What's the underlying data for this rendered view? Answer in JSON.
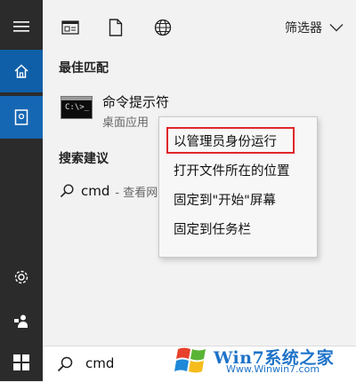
{
  "toolbar": {
    "filter_label": "筛选器",
    "icons": [
      "document-window-icon",
      "file-icon",
      "globe-icon",
      "chevron-down-icon"
    ]
  },
  "rail": {
    "icons": [
      "hamburger-menu-icon",
      "home-icon",
      "notebook-icon",
      "gear-icon",
      "person-feedback-icon",
      "windows-start-icon"
    ]
  },
  "best_match": {
    "title": "最佳匹配",
    "name": "命令提示符",
    "subtitle": "桌面应用",
    "thumb_prompt": "C:\\>_"
  },
  "suggestions": {
    "title": "搜索建议",
    "query": "cmd",
    "hint": "- 查看网"
  },
  "context_menu": {
    "items": [
      "以管理员身份运行",
      "打开文件所在的位置",
      "固定到\"开始\"屏幕",
      "固定到任务栏"
    ],
    "highlight_color": "#e0262b"
  },
  "search": {
    "value": "cmd"
  },
  "watermark": {
    "title": "Win7系统之家",
    "url": "Www.Winwin7.com"
  },
  "colors": {
    "rail_bg": "#2b2b2b",
    "rail_active": "#0f5fa8",
    "accent": "#1e73c8"
  }
}
